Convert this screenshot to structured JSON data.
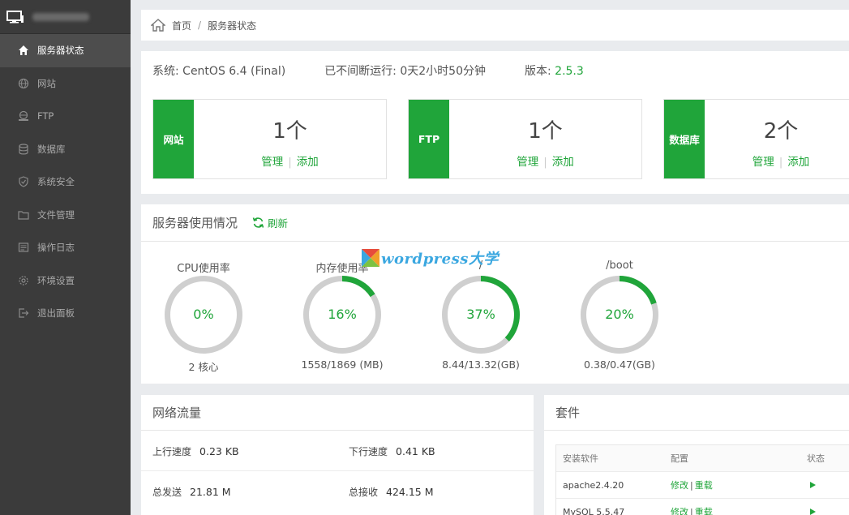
{
  "sidebar": {
    "items": [
      {
        "label": "服务器状态",
        "icon": "home-icon"
      },
      {
        "label": "网站",
        "icon": "globe-icon"
      },
      {
        "label": "FTP",
        "icon": "ftp-icon"
      },
      {
        "label": "数据库",
        "icon": "database-icon"
      },
      {
        "label": "系统安全",
        "icon": "shield-icon"
      },
      {
        "label": "文件管理",
        "icon": "folder-icon"
      },
      {
        "label": "操作日志",
        "icon": "log-icon"
      },
      {
        "label": "环境设置",
        "icon": "gear-icon"
      },
      {
        "label": "退出面板",
        "icon": "logout-icon"
      }
    ],
    "accent": "#20a53a"
  },
  "breadcrumb": {
    "home": "首页",
    "separator": "/",
    "current": "服务器状态"
  },
  "system": {
    "os_label": "系统:",
    "os_value": "CentOS 6.4 (Final)",
    "uptime_label": "已不间断运行:",
    "uptime_value": "0天2小时50分钟",
    "version_label": "版本:",
    "version_value": "2.5.3"
  },
  "cards": [
    {
      "tag": "网站",
      "count": "1个",
      "manage": "管理",
      "add": "添加"
    },
    {
      "tag": "FTP",
      "count": "1个",
      "manage": "管理",
      "add": "添加"
    },
    {
      "tag": "数据库",
      "count": "2个",
      "manage": "管理",
      "add": "添加"
    }
  ],
  "usage": {
    "title": "服务器使用情况",
    "refresh": "刷新",
    "gauges": [
      {
        "label": "CPU使用率",
        "percent": 0,
        "text": "0%",
        "sub": "2 核心"
      },
      {
        "label": "内存使用率",
        "percent": 16,
        "text": "16%",
        "sub": "1558/1869 (MB)"
      },
      {
        "label": "/",
        "percent": 37,
        "text": "37%",
        "sub": "8.44/13.32(GB)"
      },
      {
        "label": "/boot",
        "percent": 20,
        "text": "20%",
        "sub": "0.38/0.47(GB)"
      }
    ]
  },
  "watermark": {
    "text": "wordpress大学"
  },
  "network": {
    "title": "网络流量",
    "up_label": "上行速度",
    "up_value": "0.23 KB",
    "down_label": "下行速度",
    "down_value": "0.41 KB",
    "sent_label": "总发送",
    "sent_value": "21.81 M",
    "recv_label": "总接收",
    "recv_value": "424.15 M"
  },
  "packages": {
    "title": "套件",
    "headers": [
      "安装软件",
      "配置",
      "状态"
    ],
    "rows": [
      {
        "name": "apache2.4.20",
        "edit": "修改",
        "sep": "|",
        "reload": "重载"
      },
      {
        "name": "MySQL 5.5.47",
        "edit": "修改",
        "sep": "|",
        "reload": "重载"
      }
    ]
  }
}
